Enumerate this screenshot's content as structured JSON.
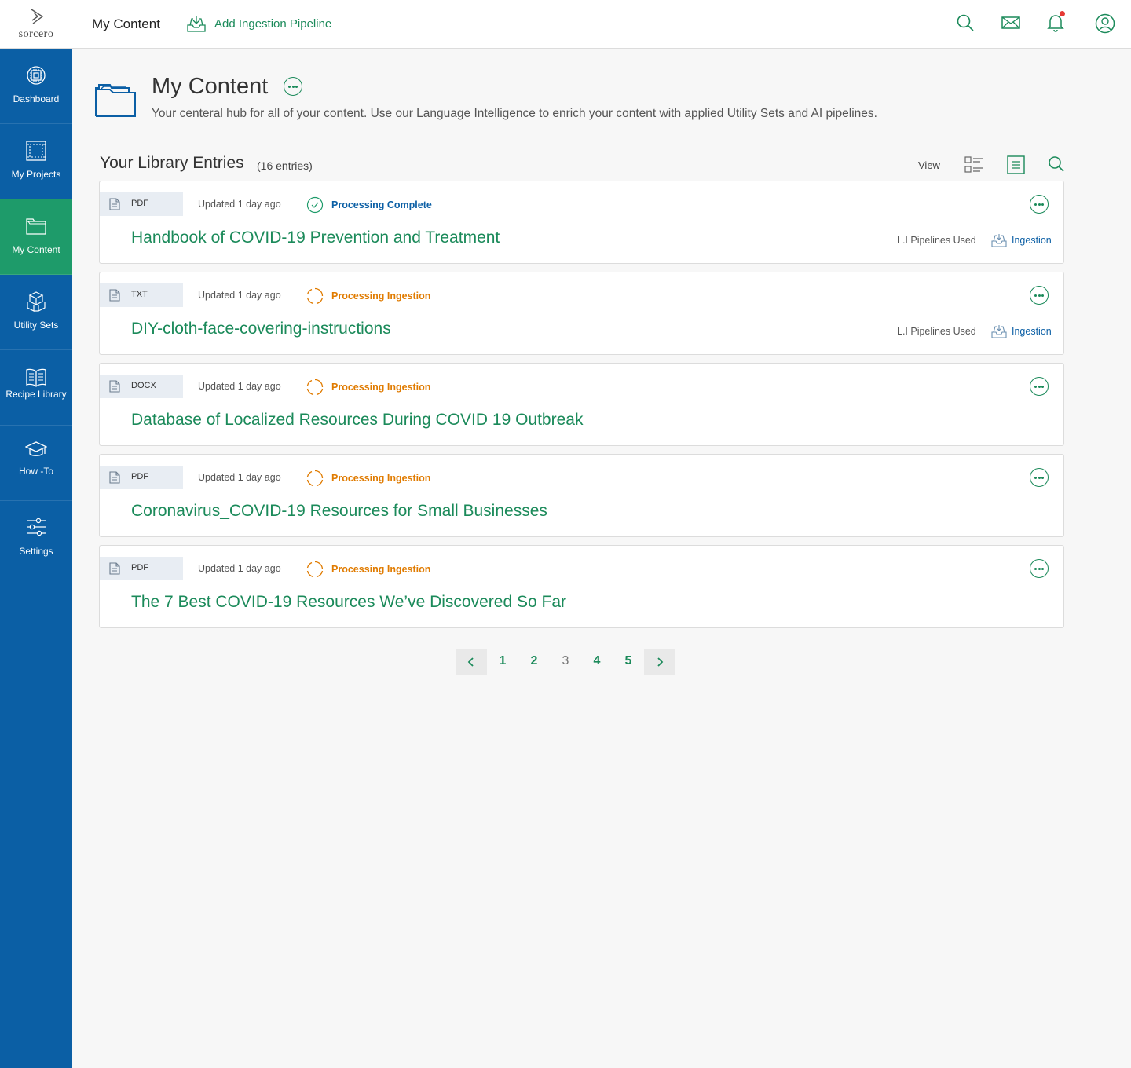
{
  "brand": {
    "name": "sorcero"
  },
  "topbar": {
    "title": "My Content",
    "add_pipeline_label": "Add Ingestion Pipeline",
    "icons": [
      "search-icon",
      "mail-icon",
      "bell-icon",
      "user-icon"
    ]
  },
  "sidebar": {
    "items": [
      {
        "label": "Dashboard",
        "icon": "chip-icon"
      },
      {
        "label": "My Projects",
        "icon": "projects-icon"
      },
      {
        "label": "My Content",
        "icon": "folder-icon",
        "active": true
      },
      {
        "label": "Utility Sets",
        "icon": "cubes-icon"
      },
      {
        "label": "Recipe Library",
        "icon": "book-icon"
      },
      {
        "label": "How -To",
        "icon": "graduation-cap-icon"
      },
      {
        "label": "Settings",
        "icon": "sliders-icon"
      }
    ]
  },
  "header": {
    "title": "My Content",
    "description": "Your centeral hub for all of your content. Use our Language Intelligence to enrich your content with applied Utility Sets and AI pipelines."
  },
  "library": {
    "title": "Your Library Entries",
    "count": "(16 entries)",
    "view_label": "View"
  },
  "entries": [
    {
      "type": "PDF",
      "updated": "Updated  1 day ago",
      "status": "Processing Complete",
      "status_kind": "complete",
      "title": "Handbook of COVID-19 Prevention and Treatment",
      "pipelines_label": "L.I Pipelines Used",
      "pipeline": "Ingestion"
    },
    {
      "type": "TXT",
      "updated": "Updated  1 day ago",
      "status": "Processing Ingestion",
      "status_kind": "processing",
      "title": "DIY-cloth-face-covering-instructions",
      "pipelines_label": "L.I Pipelines Used",
      "pipeline": "Ingestion"
    },
    {
      "type": "DOCX",
      "updated": "Updated  1 day ago",
      "status": "Processing Ingestion",
      "status_kind": "processing",
      "title": "Database of Localized Resources During COVID 19 Outbreak"
    },
    {
      "type": "PDF",
      "updated": "Updated  1 day ago",
      "status": "Processing Ingestion",
      "status_kind": "processing",
      "title": "Coronavirus_COVID-19 Resources for Small Businesses"
    },
    {
      "type": "PDF",
      "updated": "Updated  1 day ago",
      "status": "Processing Ingestion",
      "status_kind": "processing",
      "title": "The 7 Best COVID-19 Resources We’ve Discovered So Far"
    }
  ],
  "pagination": {
    "pages": [
      "1",
      "2",
      "3",
      "4",
      "5"
    ],
    "current": "3"
  },
  "colors": {
    "sidebar": "#0b5fa5",
    "active": "#1e9b6a",
    "accent": "#1b8a5a",
    "processing": "#e07b00",
    "complete": "#0b5fa5"
  }
}
